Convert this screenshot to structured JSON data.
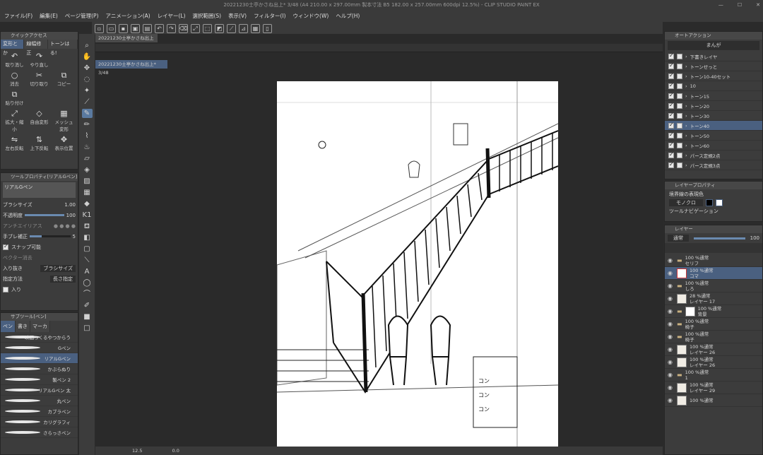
{
  "title": "20221230士亭かさね出上* 3/48 (A4 210.00 x 297.00mm 製本寸法 B5 182.00 x 257.00mm 600dpi 12.5%) - CLIP STUDIO PAINT EX",
  "window_buttons": [
    "—",
    "☐",
    "✕"
  ],
  "menu": [
    "ファイル(F)",
    "編集(E)",
    "ページ管理(P)",
    "アニメーション(A)",
    "レイヤー(L)",
    "選択範囲(S)",
    "表示(V)",
    "フィルター(I)",
    "ウィンドウ(W)",
    "ヘルプ(H)"
  ],
  "quick_access": {
    "header": "クイックアクセス",
    "tabs": [
      "変形とか",
      "線幅修正",
      "トーンはる!"
    ],
    "items": [
      {
        "icon": "↶",
        "label": "取り消し"
      },
      {
        "icon": "↷",
        "label": "やり直し"
      },
      {
        "icon": "",
        "label": ""
      },
      {
        "icon": "○",
        "label": "消去"
      },
      {
        "icon": "✂",
        "label": "切り取り"
      },
      {
        "icon": "⧉",
        "label": "コピー"
      },
      {
        "icon": "⧉",
        "label": "貼り付け"
      },
      {
        "icon": "",
        "label": ""
      },
      {
        "icon": "",
        "label": ""
      },
      {
        "icon": "⤢",
        "label": "拡大・縮小"
      },
      {
        "icon": "◇",
        "label": "自由変形"
      },
      {
        "icon": "▦",
        "label": "メッシュ変形"
      },
      {
        "icon": "⇋",
        "label": "左右反転"
      },
      {
        "icon": "⇅",
        "label": "上下反転"
      },
      {
        "icon": "✥",
        "label": "表示位置"
      }
    ]
  },
  "tool_property": {
    "header": "ツールプロパティ[リアルGペン]",
    "tool": "リアルGペン",
    "brush_size_label": "ブラシサイズ",
    "brush_size": "1.00",
    "opacity_label": "不透明度",
    "opacity": "100",
    "anti_alias_label": "アンチエイリアス",
    "stabilization_label": "手ブレ補正",
    "stabilization": "5",
    "snap_label": "スナップ可能",
    "vector_label": "ベクター消去",
    "in_out_label": "入り抜き",
    "in_out_value": "ブラシサイズ",
    "method_label": "指定方法",
    "method_value": "長さ指定",
    "in_label": "入り"
  },
  "sub_tool": {
    "header": "サブツール[ペン]",
    "tabs": [
      "ペン",
      "書き",
      "マーカ"
    ],
    "brushes": [
      "映画つくるやつからう",
      "Gペン",
      "リアルGペン",
      "かぶらぬり",
      "製ペン 2",
      "リアルGペン 太",
      "丸ペン",
      "カブラペン",
      "カリグラフィ",
      "さらっさペン"
    ],
    "selected": "リアルGペン"
  },
  "canvas": {
    "tab_top": "20221230士亭かさね出上*",
    "tab_page": "20221230士亭かさね出上* 3/48",
    "sfx": [
      "コ",
      "ン",
      "コ",
      "ン",
      "コ",
      "ン"
    ]
  },
  "bottom": {
    "zoom": "12.5",
    "angle": "0.0"
  },
  "auto_action": {
    "header": "オートアクション",
    "set": "まんが",
    "rows": [
      {
        "label": "下書きレイヤ",
        "checked": true,
        "selected": false
      },
      {
        "label": "トーンせっと",
        "checked": true,
        "selected": false
      },
      {
        "label": "トーン10-40セット",
        "checked": true,
        "selected": false
      },
      {
        "label": "10",
        "checked": true,
        "selected": false
      },
      {
        "label": "トーン15",
        "checked": true,
        "selected": false
      },
      {
        "label": "トーン20",
        "checked": true,
        "selected": false
      },
      {
        "label": "トーン30",
        "checked": true,
        "selected": false
      },
      {
        "label": "トーン40",
        "checked": true,
        "selected": true
      },
      {
        "label": "トーン50",
        "checked": true,
        "selected": false
      },
      {
        "label": "トーン60",
        "checked": true,
        "selected": false
      },
      {
        "label": "パース定規2点",
        "checked": true,
        "selected": false
      },
      {
        "label": "パース定規3点",
        "checked": true,
        "selected": false
      }
    ]
  },
  "layer_property": {
    "header": "レイヤープロパティ",
    "effect_label": "境界線の表現色",
    "color_mode": "モノクロ",
    "nav_label": "ツールナビゲーション"
  },
  "layers": {
    "header": "レイヤー",
    "blend": "通常",
    "opacity": "100",
    "rows": [
      {
        "type": "folder",
        "line1": "100 %通常",
        "line2": "セリフ",
        "selected": false
      },
      {
        "type": "layer",
        "line1": "100 %通常",
        "line2": "コマ",
        "selected": true
      },
      {
        "type": "folder",
        "line1": "100 %通常",
        "line2": "しろ",
        "selected": false
      },
      {
        "type": "layer",
        "line1": "28 %通常",
        "line2": "レイヤー 17",
        "selected": false
      },
      {
        "type": "folder",
        "line1": "100 %通常",
        "line2": "背景",
        "selected": false
      },
      {
        "type": "folder",
        "line1": "100 %通常",
        "line2": "椅子",
        "selected": false
      },
      {
        "type": "folder",
        "line1": "100 %通常",
        "line2": "椅子",
        "selected": false
      },
      {
        "type": "layer",
        "line1": "100 %通常",
        "line2": "レイヤー 26",
        "selected": false
      },
      {
        "type": "layer",
        "line1": "100 %通常",
        "line2": "レイヤー 26",
        "selected": false
      },
      {
        "type": "folder",
        "line1": "100 %通常",
        "line2": "1",
        "selected": false
      },
      {
        "type": "layer",
        "line1": "100 %通常",
        "line2": "レイヤー 29",
        "selected": false
      },
      {
        "type": "layer",
        "line1": "100 %通常",
        "line2": "",
        "selected": false
      }
    ]
  }
}
